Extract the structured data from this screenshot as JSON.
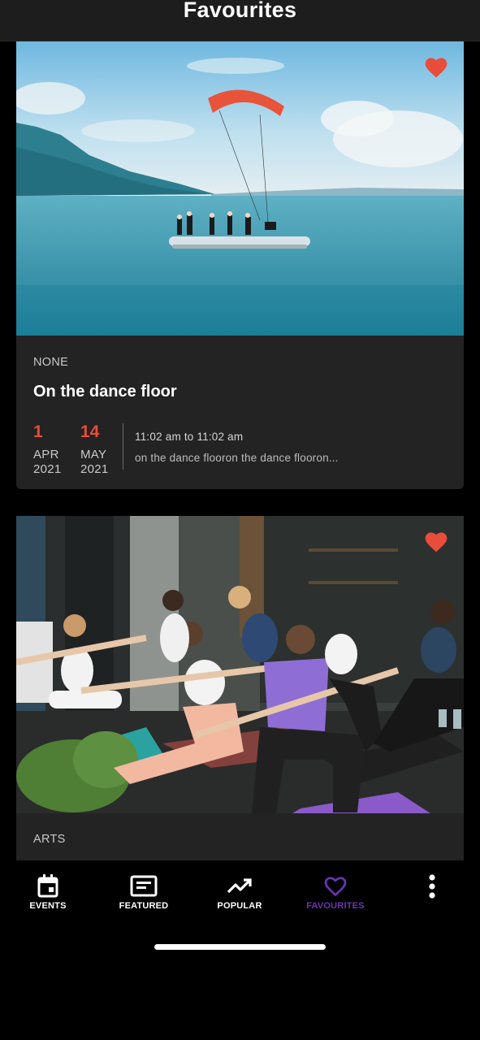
{
  "header": {
    "title": "Favourites"
  },
  "events": [
    {
      "category": "NONE",
      "title": "On the dance floor",
      "start": {
        "day": "1",
        "month": "APR",
        "year": "2021"
      },
      "end": {
        "day": "14",
        "month": "MAY",
        "year": "2021"
      },
      "time": "11:02 am to 11:02 am",
      "description": "on the dance flooron the dance flooron...",
      "image": "lake-paragliding-platform-photo",
      "favourited": true
    },
    {
      "category": "ARTS",
      "image": "yoga-class-photo",
      "favourited": true
    }
  ],
  "nav": {
    "items": [
      {
        "label": "EVENTS",
        "icon": "calendar-icon"
      },
      {
        "label": "FEATURED",
        "icon": "featured-card-icon"
      },
      {
        "label": "POPULAR",
        "icon": "trending-up-icon"
      },
      {
        "label": "FAVOURITES",
        "icon": "heart-outline-icon",
        "active": true
      }
    ],
    "more_icon": "more-vertical-icon"
  },
  "colors": {
    "accent_red": "#e94c3b",
    "active_purple": "#6d33b6",
    "card_bg": "#232323",
    "header_bg": "#1d1d1d"
  }
}
